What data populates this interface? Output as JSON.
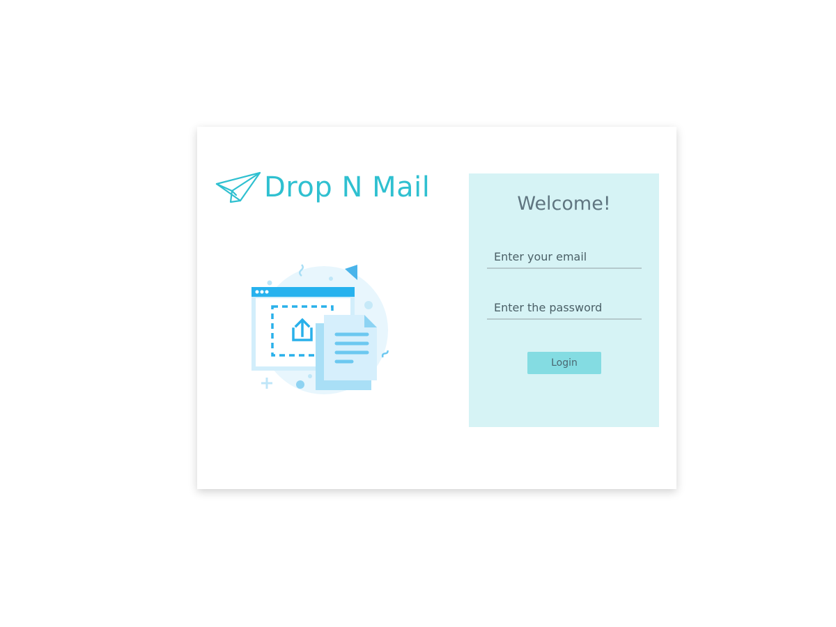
{
  "brand": {
    "name": "Drop N Mail",
    "logo_icon": "paper-plane-icon",
    "color": "#2fc0d0"
  },
  "illustration": {
    "icon": "file-upload-illustration"
  },
  "login": {
    "welcome": "Welcome!",
    "email_placeholder": "Enter your email",
    "password_placeholder": "Enter the password",
    "button_label": "Login",
    "panel_color": "#d6f3f5",
    "button_color": "#84dce2"
  }
}
